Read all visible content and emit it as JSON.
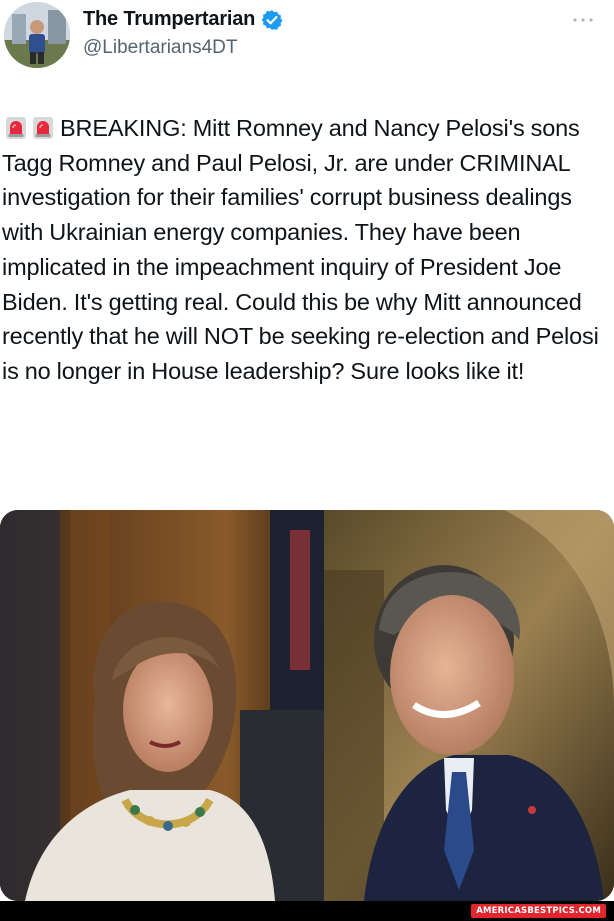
{
  "author": {
    "display_name": "The Trumpertarian",
    "handle": "@Libertarians4DT",
    "verified": true,
    "avatar_icon": "profile-photo",
    "verified_color": "#1d9bf0"
  },
  "menu": {
    "icon": "more-options-icon"
  },
  "tweet": {
    "emoji_prefix": [
      "police-light-icon",
      "police-light-icon"
    ],
    "text": "BREAKING: Mitt Romney and Nancy Pelosi's sons Tagg Romney and Paul Pelosi, Jr. are under CRIMINAL investigation for their families' corrupt business dealings with Ukrainian energy companies. They have been implicated in the impeachment inquiry of President Joe Biden. It's getting real. Could this be why Mitt announced recently that he will NOT be seeking re-election and Pelosi is no longer in House leadership? Sure looks like it!"
  },
  "media": {
    "left_photo": "woman-speaking-photo",
    "right_photo": "man-smiling-photo"
  },
  "watermark": {
    "text": "AMERICASBESTPICS.COM",
    "color": "#e3262d"
  }
}
